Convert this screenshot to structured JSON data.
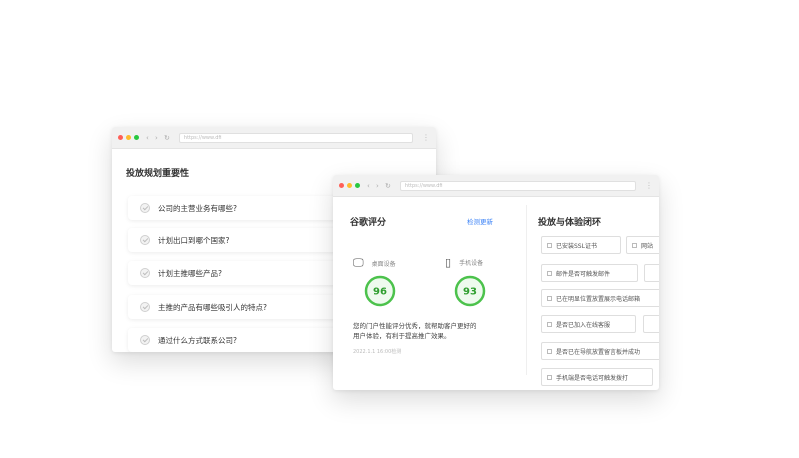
{
  "window1": {
    "url": "https://www.dfi",
    "title": "投放规划重要性",
    "questions": [
      "公司的主营业务有哪些?",
      "计划出口到哪个国家?",
      "计划主推哪些产品?",
      "主推的产品有哪些吸引人的特点?",
      "通过什么方式联系公司?"
    ]
  },
  "window2": {
    "url": "https://www.dfi",
    "google": {
      "title": "谷歌评分",
      "recheck": "检测更新",
      "desktop_label": "桌面设备",
      "desktop_score": "96",
      "mobile_label": "手机设备",
      "mobile_score": "93",
      "desc_line1": "您的门户性能评分优秀，就帮助客户更好的",
      "desc_line2": "用户体验，有利于提高推广效果。",
      "date": "2022.1.1 16:00检测"
    },
    "right": {
      "title": "投放与体验闭环",
      "items": [
        "已安装SSL证书",
        "网站",
        "邮件是否可触发邮件",
        "已在明显位置放置展示电话邮箱",
        "是否已加入在线客服",
        "是否已在导航放置留言板并成功",
        "手机端是否电话可触发拨打"
      ]
    }
  },
  "colors": {
    "accent_green": "#4cc24c",
    "link_blue": "#3b82f6",
    "dot_red": "#ff5f57",
    "dot_yellow": "#febc2e",
    "dot_green": "#28c840"
  },
  "icons": {
    "desktop": "desktop-icon",
    "mobile": "mobile-icon",
    "check": "check-circle-icon"
  }
}
